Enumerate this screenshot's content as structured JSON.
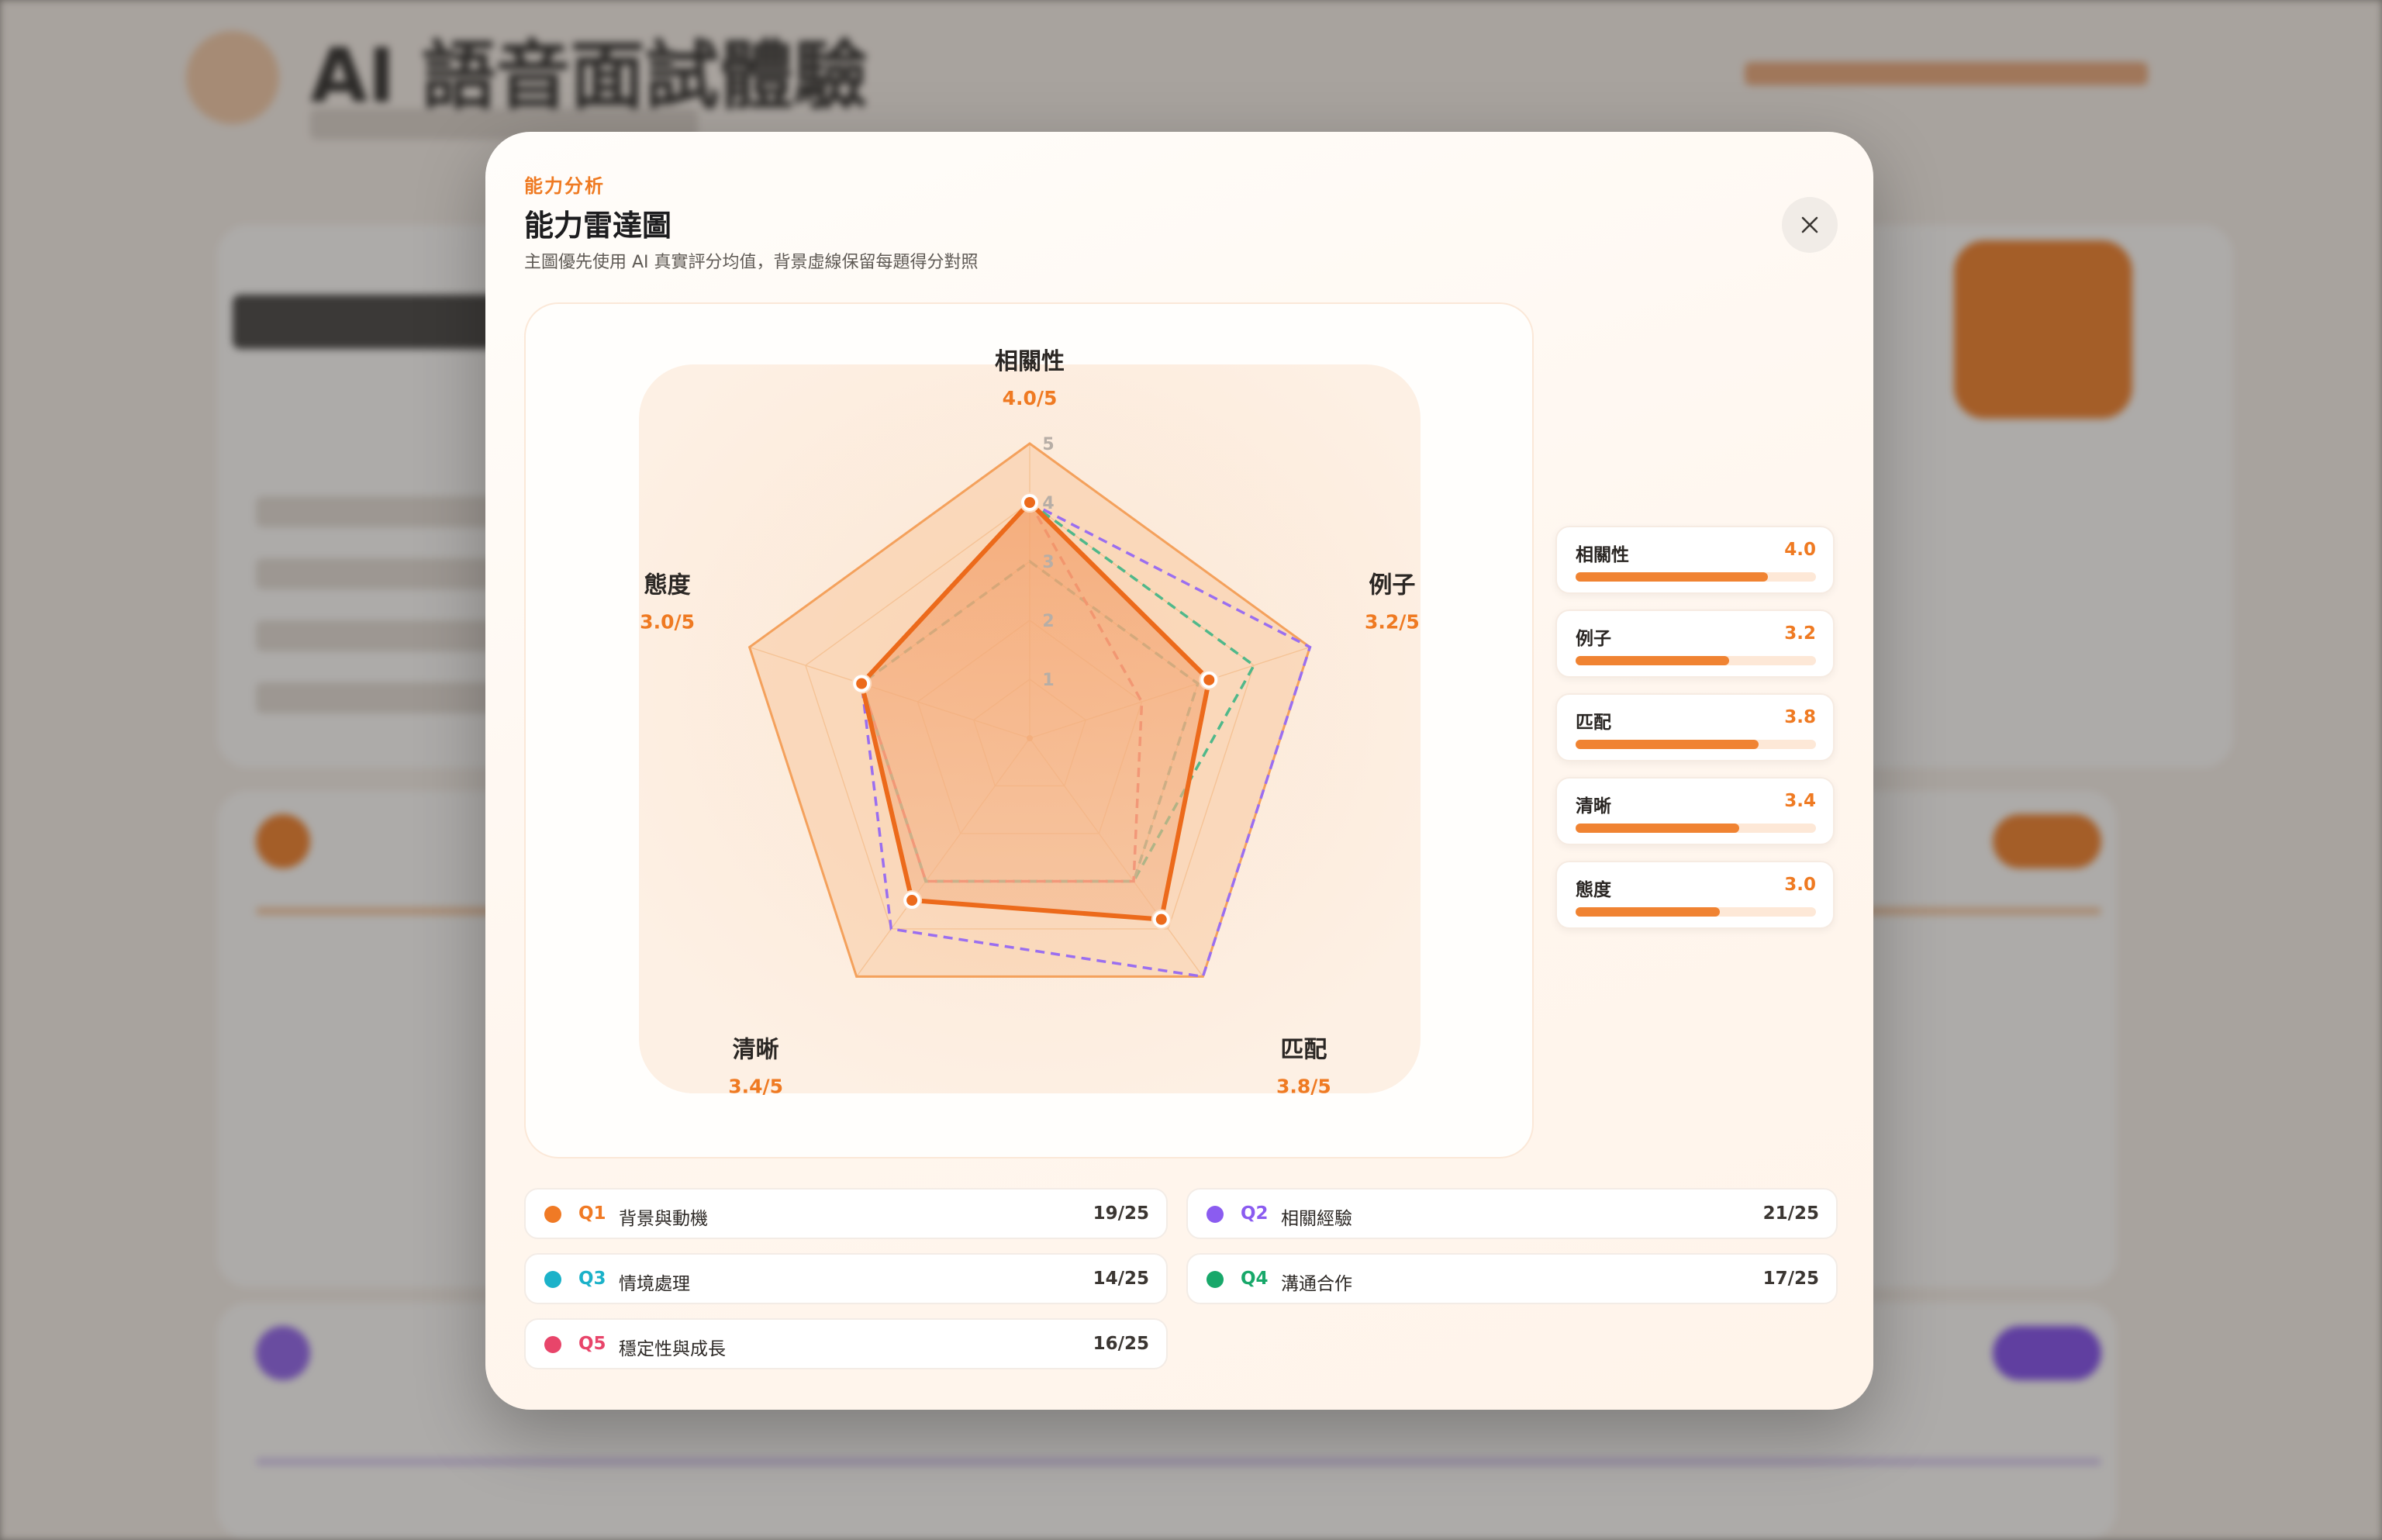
{
  "background_app": {
    "title": "AI 語音面試體驗"
  },
  "modal": {
    "eyebrow": "能力分析",
    "title": "能力雷達圖",
    "subtitle": "主圖優先使用 AI 真實評分均值，背景虛線保留每題得分對照",
    "close_icon": "close-icon"
  },
  "chart_data": {
    "type": "radar",
    "axes": [
      "相關性",
      "例子",
      "匹配",
      "清晰",
      "態度"
    ],
    "axis_value_labels": [
      "4.0/5",
      "3.2/5",
      "3.8/5",
      "3.4/5",
      "3.0/5"
    ],
    "rlim": [
      0,
      5
    ],
    "ticks": [
      "1",
      "2",
      "3",
      "4",
      "5"
    ],
    "grid": true,
    "series": [
      {
        "values": [
          4.0,
          3.2,
          3.8,
          3.4,
          3.0
        ],
        "color": "#ec6a1b",
        "style": "solid-filled"
      },
      {
        "values": [
          5,
          5,
          5,
          5,
          5
        ],
        "color": "#f4a15c",
        "style": "solid-filled-light"
      },
      {
        "values": [
          4,
          5,
          5,
          4,
          3
        ],
        "color": "#9a6ef0",
        "style": "dashed"
      },
      {
        "values": [
          4,
          4,
          3,
          3,
          3
        ],
        "color": "#4fb88a",
        "style": "dashed"
      },
      {
        "values": [
          3,
          3,
          3,
          3,
          3
        ],
        "color": "#8fae8e",
        "style": "dashed"
      },
      {
        "values": [
          4,
          2,
          3,
          3,
          3
        ],
        "color": "#f0746a",
        "style": "dashed"
      }
    ]
  },
  "score_bars": [
    {
      "label": "相關性",
      "value": "4.0",
      "ratio": 0.8
    },
    {
      "label": "例子",
      "value": "3.2",
      "ratio": 0.64
    },
    {
      "label": "匹配",
      "value": "3.8",
      "ratio": 0.76
    },
    {
      "label": "清晰",
      "value": "3.4",
      "ratio": 0.68
    },
    {
      "label": "態度",
      "value": "3.0",
      "ratio": 0.6
    }
  ],
  "questions": [
    {
      "code": "Q1",
      "name": "背景與動機",
      "score": "19/25",
      "color": "#f07a25"
    },
    {
      "code": "Q2",
      "name": "相關經驗",
      "score": "21/25",
      "color": "#8b5cf0"
    },
    {
      "code": "Q3",
      "name": "情境處理",
      "score": "14/25",
      "color": "#1bb2c9"
    },
    {
      "code": "Q4",
      "name": "溝通合作",
      "score": "17/25",
      "color": "#18a86a"
    },
    {
      "code": "Q5",
      "name": "穩定性與成長",
      "score": "16/25",
      "color": "#e8456a"
    }
  ]
}
